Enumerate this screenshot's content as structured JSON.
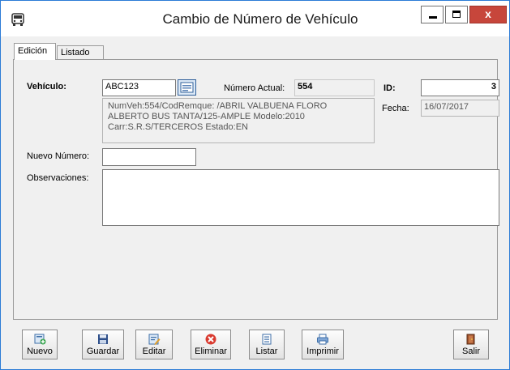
{
  "window": {
    "title": "Cambio de Número de Vehículo",
    "close_label": "x"
  },
  "tabs": [
    {
      "label": "Edición"
    },
    {
      "label": "Listado"
    }
  ],
  "form": {
    "vehiculo_label": "Vehículo:",
    "vehiculo_value": "ABC123",
    "numero_actual_label": "Número Actual:",
    "numero_actual_value": "554",
    "info_lines": [
      "NumVeh:554/CodRemque:  /ABRIL VALBUENA FLORO",
      "ALBERTO BUS TANTA/125-AMPLE Modelo:2010",
      "Carr:S.R.S/TERCEROS Estado:EN"
    ],
    "id_label": "ID:",
    "id_value": "3",
    "fecha_label": "Fecha:",
    "fecha_value": "16/07/2017",
    "nuevo_numero_label": "Nuevo Número:",
    "nuevo_numero_value": "",
    "observaciones_label": "Observaciones:",
    "observaciones_value": ""
  },
  "toolbar": {
    "nuevo": "Nuevo",
    "guardar": "Guardar",
    "editar": "Editar",
    "eliminar": "Eliminar",
    "listar": "Listar",
    "imprimir": "Imprimir",
    "salir": "Salir"
  },
  "icons": {
    "app": "bus-icon",
    "lookup": "card-lookup-icon",
    "nuevo": "new-document-icon",
    "guardar": "save-disk-icon",
    "editar": "edit-document-icon",
    "eliminar": "delete-circle-icon",
    "listar": "list-document-icon",
    "imprimir": "printer-icon",
    "salir": "exit-door-icon"
  },
  "colors": {
    "window_border": "#2b7bd6",
    "close_button": "#c7463b",
    "panel_bg": "#f0f0f0"
  }
}
